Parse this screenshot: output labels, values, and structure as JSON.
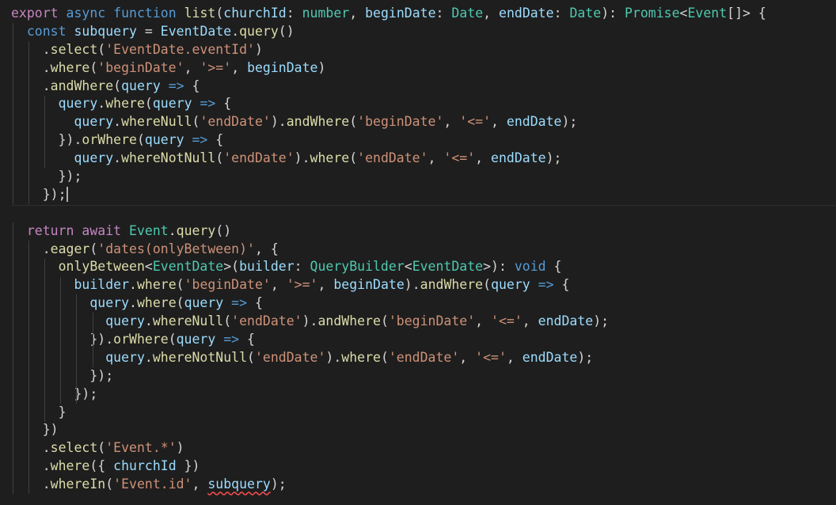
{
  "colors": {
    "background": "#1e1e1e",
    "keyword": "#569cd6",
    "control": "#c586c0",
    "function": "#dcdcaa",
    "variable": "#9cdcfe",
    "type": "#4ec9b0",
    "string": "#ce9178",
    "punctuation": "#d4d4d4",
    "error_underline": "#f14c4c"
  },
  "editor": {
    "cursor_line": 11,
    "error_token": "subquery",
    "lines": [
      [
        [
          "c",
          "export"
        ],
        [
          "p",
          " "
        ],
        [
          "k",
          "async"
        ],
        [
          "p",
          " "
        ],
        [
          "k",
          "function"
        ],
        [
          "p",
          " "
        ],
        [
          "f",
          "list"
        ],
        [
          "p",
          "("
        ],
        [
          "v",
          "churchId"
        ],
        [
          "p",
          ": "
        ],
        [
          "t",
          "number"
        ],
        [
          "p",
          ", "
        ],
        [
          "v",
          "beginDate"
        ],
        [
          "p",
          ": "
        ],
        [
          "t",
          "Date"
        ],
        [
          "p",
          ", "
        ],
        [
          "v",
          "endDate"
        ],
        [
          "p",
          ": "
        ],
        [
          "t",
          "Date"
        ],
        [
          "p",
          "): "
        ],
        [
          "t",
          "Promise"
        ],
        [
          "p",
          "<"
        ],
        [
          "t",
          "Event"
        ],
        [
          "p",
          "[]> {"
        ]
      ],
      [
        [
          "p",
          "  "
        ],
        [
          "k",
          "const"
        ],
        [
          "p",
          " "
        ],
        [
          "v",
          "subquery"
        ],
        [
          "p",
          " = "
        ],
        [
          "v",
          "EventDate"
        ],
        [
          "p",
          "."
        ],
        [
          "f",
          "query"
        ],
        [
          "p",
          "()"
        ]
      ],
      [
        [
          "p",
          "    ."
        ],
        [
          "f",
          "select"
        ],
        [
          "p",
          "("
        ],
        [
          "s",
          "'EventDate.eventId'"
        ],
        [
          "p",
          ")"
        ]
      ],
      [
        [
          "p",
          "    ."
        ],
        [
          "f",
          "where"
        ],
        [
          "p",
          "("
        ],
        [
          "s",
          "'beginDate'"
        ],
        [
          "p",
          ", "
        ],
        [
          "s",
          "'>='"
        ],
        [
          "p",
          ", "
        ],
        [
          "v",
          "beginDate"
        ],
        [
          "p",
          ")"
        ]
      ],
      [
        [
          "p",
          "    ."
        ],
        [
          "f",
          "andWhere"
        ],
        [
          "p",
          "("
        ],
        [
          "v",
          "query"
        ],
        [
          "p",
          " "
        ],
        [
          "k",
          "=>"
        ],
        [
          "p",
          " {"
        ]
      ],
      [
        [
          "p",
          "      "
        ],
        [
          "v",
          "query"
        ],
        [
          "p",
          "."
        ],
        [
          "f",
          "where"
        ],
        [
          "p",
          "("
        ],
        [
          "v",
          "query"
        ],
        [
          "p",
          " "
        ],
        [
          "k",
          "=>"
        ],
        [
          "p",
          " {"
        ]
      ],
      [
        [
          "p",
          "        "
        ],
        [
          "v",
          "query"
        ],
        [
          "p",
          "."
        ],
        [
          "f",
          "whereNull"
        ],
        [
          "p",
          "("
        ],
        [
          "s",
          "'endDate'"
        ],
        [
          "p",
          ")."
        ],
        [
          "f",
          "andWhere"
        ],
        [
          "p",
          "("
        ],
        [
          "s",
          "'beginDate'"
        ],
        [
          "p",
          ", "
        ],
        [
          "s",
          "'<='"
        ],
        [
          "p",
          ", "
        ],
        [
          "v",
          "endDate"
        ],
        [
          "p",
          ");"
        ]
      ],
      [
        [
          "p",
          "      })."
        ],
        [
          "f",
          "orWhere"
        ],
        [
          "p",
          "("
        ],
        [
          "v",
          "query"
        ],
        [
          "p",
          " "
        ],
        [
          "k",
          "=>"
        ],
        [
          "p",
          " {"
        ]
      ],
      [
        [
          "p",
          "        "
        ],
        [
          "v",
          "query"
        ],
        [
          "p",
          "."
        ],
        [
          "f",
          "whereNotNull"
        ],
        [
          "p",
          "("
        ],
        [
          "s",
          "'endDate'"
        ],
        [
          "p",
          ")."
        ],
        [
          "f",
          "where"
        ],
        [
          "p",
          "("
        ],
        [
          "s",
          "'endDate'"
        ],
        [
          "p",
          ", "
        ],
        [
          "s",
          "'<='"
        ],
        [
          "p",
          ", "
        ],
        [
          "v",
          "endDate"
        ],
        [
          "p",
          ");"
        ]
      ],
      [
        [
          "p",
          "      });"
        ]
      ],
      [
        [
          "p",
          "    });"
        ]
      ],
      [
        [
          "p",
          ""
        ]
      ],
      [
        [
          "p",
          "  "
        ],
        [
          "c",
          "return"
        ],
        [
          "p",
          " "
        ],
        [
          "c",
          "await"
        ],
        [
          "p",
          " "
        ],
        [
          "t",
          "Event"
        ],
        [
          "p",
          "."
        ],
        [
          "f",
          "query"
        ],
        [
          "p",
          "()"
        ]
      ],
      [
        [
          "p",
          "    ."
        ],
        [
          "f",
          "eager"
        ],
        [
          "p",
          "("
        ],
        [
          "s",
          "'dates(onlyBetween)'"
        ],
        [
          "p",
          ", {"
        ]
      ],
      [
        [
          "p",
          "      "
        ],
        [
          "f",
          "onlyBetween"
        ],
        [
          "p",
          "<"
        ],
        [
          "t",
          "EventDate"
        ],
        [
          "p",
          ">("
        ],
        [
          "v",
          "builder"
        ],
        [
          "p",
          ": "
        ],
        [
          "t",
          "QueryBuilder"
        ],
        [
          "p",
          "<"
        ],
        [
          "t",
          "EventDate"
        ],
        [
          "p",
          ">): "
        ],
        [
          "k",
          "void"
        ],
        [
          "p",
          " {"
        ]
      ],
      [
        [
          "p",
          "        "
        ],
        [
          "v",
          "builder"
        ],
        [
          "p",
          "."
        ],
        [
          "f",
          "where"
        ],
        [
          "p",
          "("
        ],
        [
          "s",
          "'beginDate'"
        ],
        [
          "p",
          ", "
        ],
        [
          "s",
          "'>='"
        ],
        [
          "p",
          ", "
        ],
        [
          "v",
          "beginDate"
        ],
        [
          "p",
          ")."
        ],
        [
          "f",
          "andWhere"
        ],
        [
          "p",
          "("
        ],
        [
          "v",
          "query"
        ],
        [
          "p",
          " "
        ],
        [
          "k",
          "=>"
        ],
        [
          "p",
          " {"
        ]
      ],
      [
        [
          "p",
          "          "
        ],
        [
          "v",
          "query"
        ],
        [
          "p",
          "."
        ],
        [
          "f",
          "where"
        ],
        [
          "p",
          "("
        ],
        [
          "v",
          "query"
        ],
        [
          "p",
          " "
        ],
        [
          "k",
          "=>"
        ],
        [
          "p",
          " {"
        ]
      ],
      [
        [
          "p",
          "            "
        ],
        [
          "v",
          "query"
        ],
        [
          "p",
          "."
        ],
        [
          "f",
          "whereNull"
        ],
        [
          "p",
          "("
        ],
        [
          "s",
          "'endDate'"
        ],
        [
          "p",
          ")."
        ],
        [
          "f",
          "andWhere"
        ],
        [
          "p",
          "("
        ],
        [
          "s",
          "'beginDate'"
        ],
        [
          "p",
          ", "
        ],
        [
          "s",
          "'<='"
        ],
        [
          "p",
          ", "
        ],
        [
          "v",
          "endDate"
        ],
        [
          "p",
          ");"
        ]
      ],
      [
        [
          "p",
          "          })."
        ],
        [
          "f",
          "orWhere"
        ],
        [
          "p",
          "("
        ],
        [
          "v",
          "query"
        ],
        [
          "p",
          " "
        ],
        [
          "k",
          "=>"
        ],
        [
          "p",
          " {"
        ]
      ],
      [
        [
          "p",
          "            "
        ],
        [
          "v",
          "query"
        ],
        [
          "p",
          "."
        ],
        [
          "f",
          "whereNotNull"
        ],
        [
          "p",
          "("
        ],
        [
          "s",
          "'endDate'"
        ],
        [
          "p",
          ")."
        ],
        [
          "f",
          "where"
        ],
        [
          "p",
          "("
        ],
        [
          "s",
          "'endDate'"
        ],
        [
          "p",
          ", "
        ],
        [
          "s",
          "'<='"
        ],
        [
          "p",
          ", "
        ],
        [
          "v",
          "endDate"
        ],
        [
          "p",
          ");"
        ]
      ],
      [
        [
          "p",
          "          });"
        ]
      ],
      [
        [
          "p",
          "        });"
        ]
      ],
      [
        [
          "p",
          "      }"
        ]
      ],
      [
        [
          "p",
          "    })"
        ]
      ],
      [
        [
          "p",
          "    ."
        ],
        [
          "f",
          "select"
        ],
        [
          "p",
          "("
        ],
        [
          "s",
          "'Event.*'"
        ],
        [
          "p",
          ")"
        ]
      ],
      [
        [
          "p",
          "    ."
        ],
        [
          "f",
          "where"
        ],
        [
          "p",
          "({ "
        ],
        [
          "v",
          "churchId"
        ],
        [
          "p",
          " })"
        ]
      ],
      [
        [
          "p",
          "    ."
        ],
        [
          "f",
          "whereIn"
        ],
        [
          "p",
          "("
        ],
        [
          "s",
          "'Event.id'"
        ],
        [
          "p",
          ", "
        ],
        [
          "e",
          "subquery"
        ],
        [
          "p",
          ");"
        ]
      ]
    ]
  }
}
